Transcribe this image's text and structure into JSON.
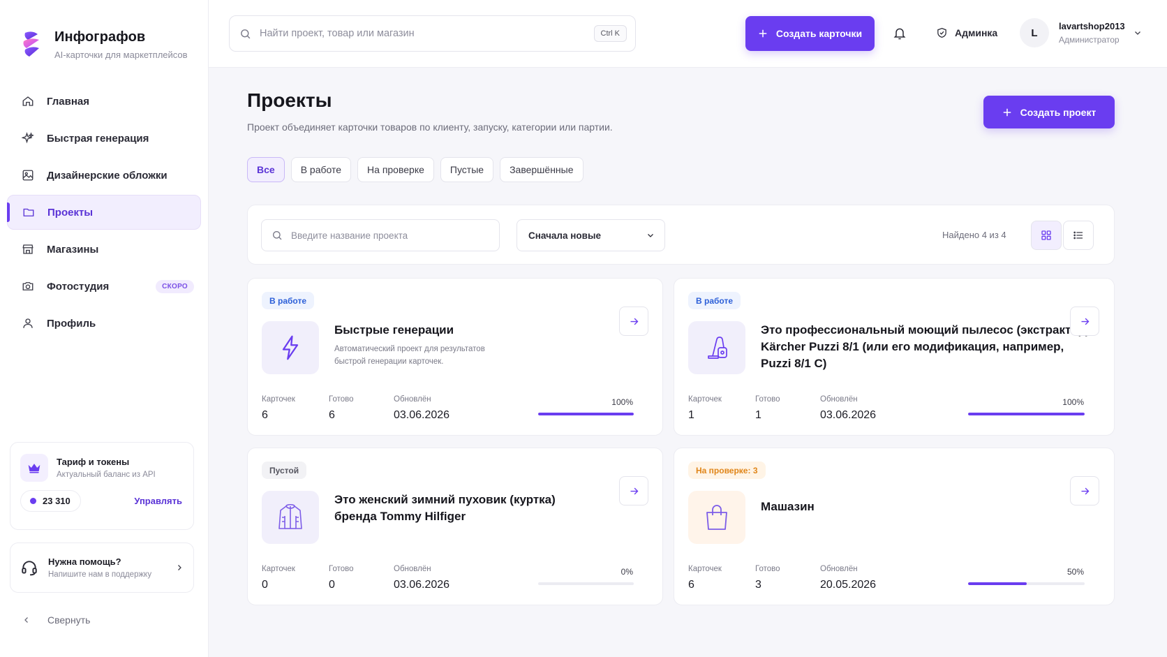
{
  "brand": {
    "title": "Инфографов",
    "subtitle": "AI-карточки для маркетплейсов"
  },
  "nav": [
    {
      "label": "Главная",
      "icon": "home-icon"
    },
    {
      "label": "Быстрая генерация",
      "icon": "sparkle-icon"
    },
    {
      "label": "Дизайнерские обложки",
      "icon": "image-icon"
    },
    {
      "label": "Проекты",
      "icon": "folder-icon",
      "active": true
    },
    {
      "label": "Магазины",
      "icon": "store-icon"
    },
    {
      "label": "Фотостудия",
      "icon": "camera-icon",
      "badge": "СКОРО"
    },
    {
      "label": "Профиль",
      "icon": "user-icon"
    }
  ],
  "tariff": {
    "title": "Тариф и токены",
    "subtitle": "Актуальный баланс из API",
    "balance": "23 310",
    "manage": "Управлять"
  },
  "help": {
    "title": "Нужна помощь?",
    "subtitle": "Напишите нам в поддержку"
  },
  "collapse": "Свернуть",
  "topbar": {
    "search_placeholder": "Найти проект, товар или магазин",
    "shortcut": "Ctrl K",
    "create_cards": "Создать карточки",
    "admin": "Админка",
    "user": {
      "initial": "L",
      "name": "lavartshop2013",
      "role": "Администратор"
    }
  },
  "page": {
    "title": "Проекты",
    "subtitle": "Проект объединяет карточки товаров по клиенту, запуску, категории или партии.",
    "create_project": "Создать проект",
    "filters": [
      "Все",
      "В работе",
      "На проверке",
      "Пустые",
      "Завершённые"
    ],
    "search_placeholder": "Введите название проекта",
    "sort": "Сначала новые",
    "found": "Найдено 4 из 4"
  },
  "stat_labels": {
    "cards": "Карточек",
    "ready": "Готово",
    "updated": "Обновлён"
  },
  "projects": [
    {
      "badge": "В работе",
      "title": "Быстрые генерации",
      "desc": "Автоматический проект для результатов быстрой генерации карточек.",
      "cards": "6",
      "ready": "6",
      "updated": "03.06.2026",
      "progress": "100%",
      "progress_value": 100,
      "icon": "lightning-icon"
    },
    {
      "badge": "В работе",
      "title": "Это профессиональный моющий пылесос (экстрактор) Kärcher Puzzi 8/1 (или его модификация, например, Puzzi 8/1 C)",
      "desc": "",
      "cards": "1",
      "ready": "1",
      "updated": "03.06.2026",
      "progress": "100%",
      "progress_value": 100,
      "icon": "vacuum-icon"
    },
    {
      "badge": "Пустой",
      "title": "Это женский зимний пуховик (куртка) бренда Tommy Hilfiger",
      "desc": "",
      "cards": "0",
      "ready": "0",
      "updated": "03.06.2026",
      "progress": "0%",
      "progress_value": 0,
      "icon": "jacket-icon"
    },
    {
      "badge": "На проверке: 3",
      "title": "Машазин",
      "desc": "",
      "cards": "6",
      "ready": "3",
      "updated": "20.05.2026",
      "progress": "50%",
      "progress_value": 50,
      "icon": "shopping-bag-icon"
    }
  ],
  "colors": {
    "accent": "#6a3df0",
    "badge_work": "#2c5fd8",
    "badge_review": "#e0861a"
  }
}
